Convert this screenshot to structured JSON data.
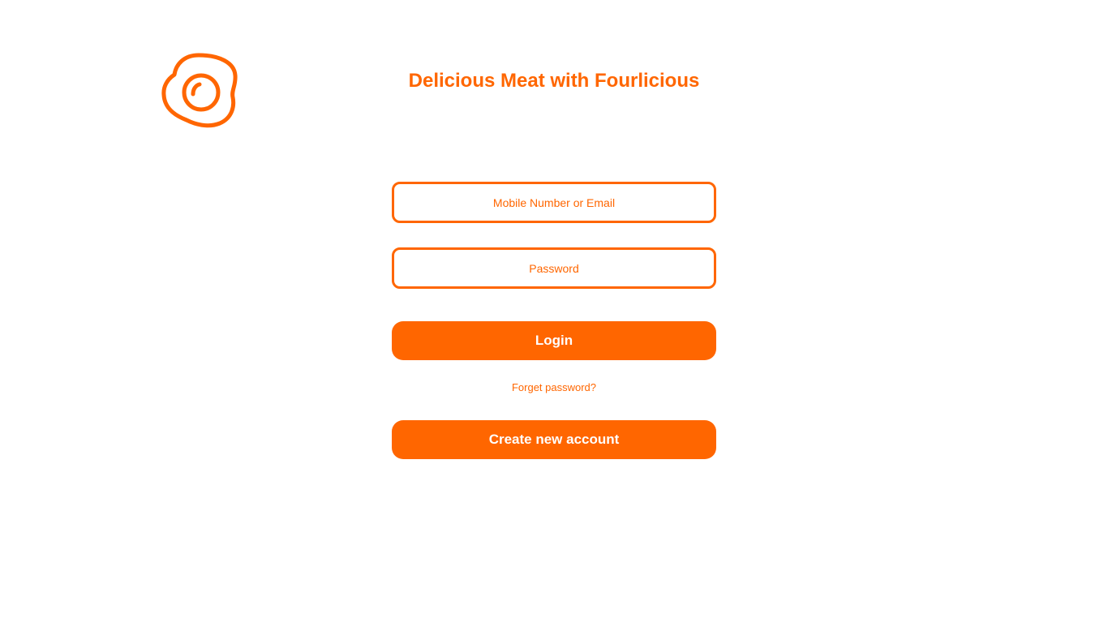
{
  "brand": {
    "logo_icon": "fried-egg-icon",
    "accent_color": "#ff6600"
  },
  "header": {
    "title": "Delicious Meat with Fourlicious"
  },
  "login_form": {
    "identifier_placeholder": "Mobile Number or Email",
    "password_placeholder": "Password",
    "login_label": "Login",
    "forgot_label": "Forget password?",
    "create_account_label": "Create new account"
  }
}
